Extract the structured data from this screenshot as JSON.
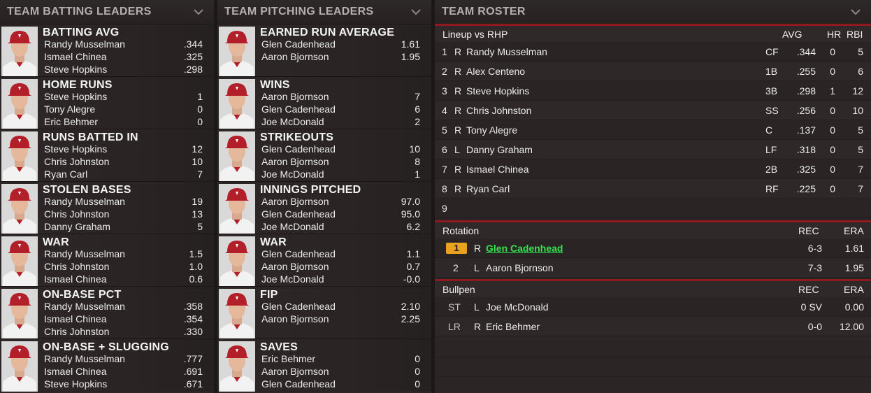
{
  "batting": {
    "title": "TEAM BATTING LEADERS",
    "cards": [
      {
        "category": "BATTING AVG",
        "rows": [
          {
            "name": "Randy Musselman",
            "value": ".344"
          },
          {
            "name": "Ismael Chinea",
            "value": ".325"
          },
          {
            "name": "Steve Hopkins",
            "value": ".298"
          }
        ]
      },
      {
        "category": "HOME RUNS",
        "rows": [
          {
            "name": "Steve Hopkins",
            "value": "1"
          },
          {
            "name": "Tony Alegre",
            "value": "0"
          },
          {
            "name": "Eric Behmer",
            "value": "0"
          }
        ]
      },
      {
        "category": "RUNS BATTED IN",
        "rows": [
          {
            "name": "Steve Hopkins",
            "value": "12"
          },
          {
            "name": "Chris Johnston",
            "value": "10"
          },
          {
            "name": "Ryan Carl",
            "value": "7"
          }
        ]
      },
      {
        "category": "STOLEN BASES",
        "rows": [
          {
            "name": "Randy Musselman",
            "value": "19"
          },
          {
            "name": "Chris Johnston",
            "value": "13"
          },
          {
            "name": "Danny Graham",
            "value": "5"
          }
        ]
      },
      {
        "category": "WAR",
        "rows": [
          {
            "name": "Randy Musselman",
            "value": "1.5"
          },
          {
            "name": "Chris Johnston",
            "value": "1.0"
          },
          {
            "name": "Ismael Chinea",
            "value": "0.6"
          }
        ]
      },
      {
        "category": "ON-BASE PCT",
        "rows": [
          {
            "name": "Randy Musselman",
            "value": ".358"
          },
          {
            "name": "Ismael Chinea",
            "value": ".354"
          },
          {
            "name": "Chris Johnston",
            "value": ".330"
          }
        ]
      },
      {
        "category": "ON-BASE + SLUGGING",
        "rows": [
          {
            "name": "Randy Musselman",
            "value": ".777"
          },
          {
            "name": "Ismael Chinea",
            "value": ".691"
          },
          {
            "name": "Steve Hopkins",
            "value": ".671"
          }
        ]
      }
    ]
  },
  "pitching": {
    "title": "TEAM PITCHING LEADERS",
    "cards": [
      {
        "category": "EARNED RUN AVERAGE",
        "rows": [
          {
            "name": "Glen Cadenhead",
            "value": "1.61"
          },
          {
            "name": "Aaron Bjornson",
            "value": "1.95"
          }
        ]
      },
      {
        "category": "WINS",
        "rows": [
          {
            "name": "Aaron Bjornson",
            "value": "7"
          },
          {
            "name": "Glen Cadenhead",
            "value": "6"
          },
          {
            "name": "Joe McDonald",
            "value": "2"
          }
        ]
      },
      {
        "category": "STRIKEOUTS",
        "rows": [
          {
            "name": "Glen Cadenhead",
            "value": "10"
          },
          {
            "name": "Aaron Bjornson",
            "value": "8"
          },
          {
            "name": "Joe McDonald",
            "value": "1"
          }
        ]
      },
      {
        "category": "INNINGS PITCHED",
        "rows": [
          {
            "name": "Aaron Bjornson",
            "value": "97.0"
          },
          {
            "name": "Glen Cadenhead",
            "value": "95.0"
          },
          {
            "name": "Joe McDonald",
            "value": "6.2"
          }
        ]
      },
      {
        "category": "WAR",
        "rows": [
          {
            "name": "Glen Cadenhead",
            "value": "1.1"
          },
          {
            "name": "Aaron Bjornson",
            "value": "0.7"
          },
          {
            "name": "Joe McDonald",
            "value": "-0.0"
          }
        ]
      },
      {
        "category": "FIP",
        "rows": [
          {
            "name": "Glen Cadenhead",
            "value": "2.10"
          },
          {
            "name": "Aaron Bjornson",
            "value": "2.25"
          }
        ]
      },
      {
        "category": "SAVES",
        "rows": [
          {
            "name": "Eric Behmer",
            "value": "0"
          },
          {
            "name": "Aaron Bjornson",
            "value": "0"
          },
          {
            "name": "Glen Cadenhead",
            "value": "0"
          }
        ]
      }
    ]
  },
  "roster": {
    "title": "TEAM ROSTER",
    "lineup": {
      "label": "Lineup vs RHP",
      "headers": {
        "avg": "AVG",
        "hr": "HR",
        "rbi": "RBI"
      },
      "rows": [
        {
          "num": "1",
          "bats": "R",
          "name": "Randy Musselman",
          "pos": "CF",
          "avg": ".344",
          "hr": "0",
          "rbi": "5"
        },
        {
          "num": "2",
          "bats": "R",
          "name": "Alex Centeno",
          "pos": "1B",
          "avg": ".255",
          "hr": "0",
          "rbi": "6"
        },
        {
          "num": "3",
          "bats": "R",
          "name": "Steve Hopkins",
          "pos": "3B",
          "avg": ".298",
          "hr": "1",
          "rbi": "12"
        },
        {
          "num": "4",
          "bats": "R",
          "name": "Chris Johnston",
          "pos": "SS",
          "avg": ".256",
          "hr": "0",
          "rbi": "10"
        },
        {
          "num": "5",
          "bats": "R",
          "name": "Tony Alegre",
          "pos": "C",
          "avg": ".137",
          "hr": "0",
          "rbi": "5"
        },
        {
          "num": "6",
          "bats": "L",
          "name": "Danny Graham",
          "pos": "LF",
          "avg": ".318",
          "hr": "0",
          "rbi": "5"
        },
        {
          "num": "7",
          "bats": "R",
          "name": "Ismael Chinea",
          "pos": "2B",
          "avg": ".325",
          "hr": "0",
          "rbi": "7"
        },
        {
          "num": "8",
          "bats": "R",
          "name": "Ryan Carl",
          "pos": "RF",
          "avg": ".225",
          "hr": "0",
          "rbi": "7"
        },
        {
          "num": "9",
          "bats": "",
          "name": "",
          "pos": "",
          "avg": "",
          "hr": "",
          "rbi": ""
        }
      ]
    },
    "rotation": {
      "label": "Rotation",
      "headers": {
        "rec": "REC",
        "era": "ERA"
      },
      "rows": [
        {
          "num": "1",
          "throws": "R",
          "name": "Glen Cadenhead",
          "rec": "6-3",
          "era": "1.61"
        },
        {
          "num": "2",
          "throws": "L",
          "name": "Aaron Bjornson",
          "rec": "7-3",
          "era": "1.95"
        }
      ]
    },
    "bullpen": {
      "label": "Bullpen",
      "headers": {
        "rec": "REC",
        "era": "ERA"
      },
      "rows": [
        {
          "role": "ST",
          "throws": "L",
          "name": "Joe McDonald",
          "rec": "0 SV",
          "era": "0.00"
        },
        {
          "role": "LR",
          "throws": "R",
          "name": "Eric Behmer",
          "rec": "0-0",
          "era": "12.00"
        }
      ]
    }
  },
  "colors": {
    "accent_red": "#8e1a1f",
    "link_green": "#33e24f",
    "badge_orange": "#e8a21e"
  },
  "icons": {
    "collapse": "chevron-down-icon",
    "player": "player-headshot-icon"
  }
}
